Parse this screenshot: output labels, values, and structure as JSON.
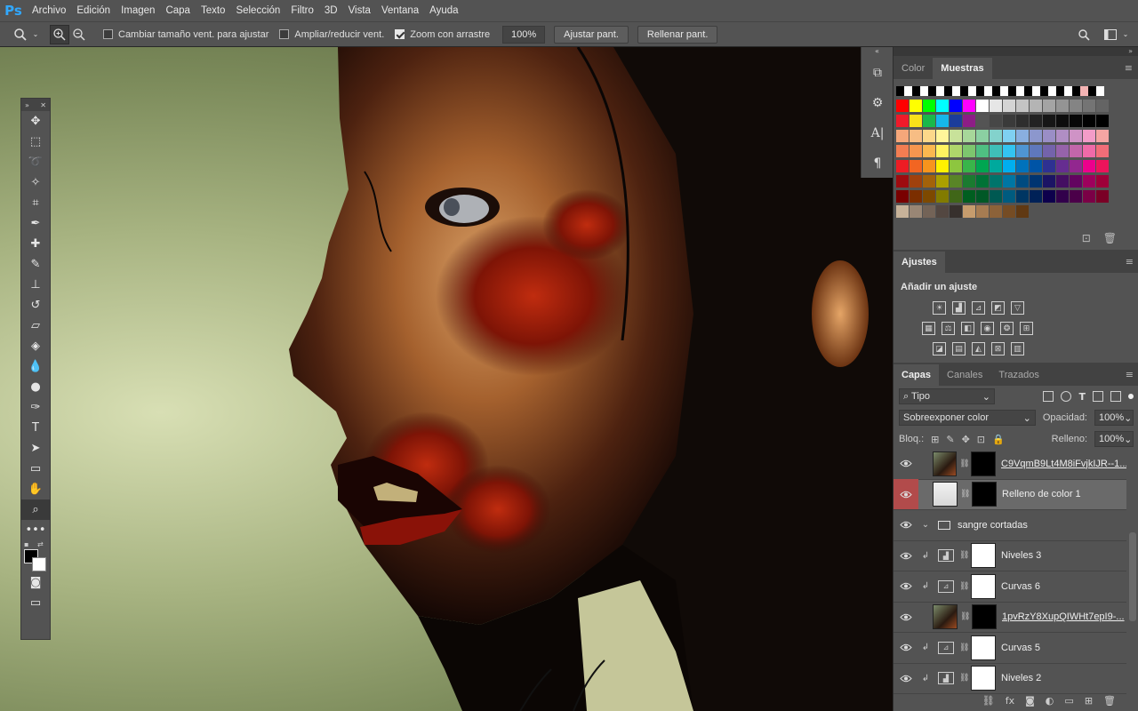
{
  "app": {
    "logo": "Ps"
  },
  "menu": [
    "Archivo",
    "Edición",
    "Imagen",
    "Capa",
    "Texto",
    "Selección",
    "Filtro",
    "3D",
    "Vista",
    "Ventana",
    "Ayuda"
  ],
  "options": {
    "resize_windows": "Cambiar tamaño vent. para ajustar",
    "zoom_all": "Ampliar/reducir vent.",
    "scrubby_zoom": "Zoom con arrastre",
    "zoom_value": "100%",
    "fit_screen": "Ajustar pant.",
    "fill_screen": "Rellenar pant."
  },
  "tools": [
    "move-icon",
    "marquee-icon",
    "lasso-icon",
    "quick-select-icon",
    "crop-icon",
    "eyedropper-icon",
    "healing-brush-icon",
    "brush-icon",
    "stamp-icon",
    "history-brush-icon",
    "eraser-icon",
    "paint-bucket-icon",
    "blur-icon",
    "dodge-icon",
    "pen-icon",
    "type-icon",
    "path-select-icon",
    "rectangle-icon",
    "hand-icon",
    "zoom-icon",
    "more-icon"
  ],
  "swatches_panel": {
    "tabs": [
      "Color",
      "Muestras"
    ],
    "active_tab": "Muestras",
    "rows": [
      [
        "#000000",
        "#ffffff",
        "#000000",
        "#ffffff",
        "#000000",
        "#ffffff",
        "#000000",
        "#ffffff",
        "#000000",
        "#ffffff",
        "#000000",
        "#ffffff",
        "#000000",
        "#ffffff",
        "#000000",
        "#ffffff",
        "#000000",
        "#ffffff",
        "#000000",
        "#ffffff",
        "#000000",
        "#ffffff",
        "#000000",
        "#f4b4b4",
        "#000000",
        "#ffffff"
      ],
      [
        "#ff0000",
        "#ffff00",
        "#00ff00",
        "#00ffff",
        "#0000ff",
        "#ff00ff",
        "#ffffff",
        "#e6e6e6",
        "#d4d4d4",
        "#c4c4c4",
        "#b4b4b4",
        "#a4a4a4",
        "#949494",
        "#848484",
        "#747474",
        "#646464"
      ],
      [
        "#ef1a2a",
        "#f8e11a",
        "#1ab84a",
        "#16b7ea",
        "#1b3c9a",
        "#8d1d86",
        "#545454",
        "#474747",
        "#3a3a3a",
        "#2e2e2e",
        "#222222",
        "#161616",
        "#0d0d0d",
        "#070707",
        "#020202",
        "#000000"
      ],
      [
        "#f5a77a",
        "#f7bd84",
        "#fcd88a",
        "#fff59a",
        "#c8e29a",
        "#a7d79a",
        "#8bd0a2",
        "#83d2cc",
        "#7fd0f1",
        "#89afdf",
        "#8c97cd",
        "#9a8ec6",
        "#b08ec4",
        "#cf93c6",
        "#f39cc8",
        "#f5a5a3"
      ],
      [
        "#f27d52",
        "#f6964f",
        "#fbb84f",
        "#fff360",
        "#afd66b",
        "#7dc66e",
        "#4fbf82",
        "#3fbfb8",
        "#33c4f1",
        "#4f95d2",
        "#5f78bc",
        "#7463ab",
        "#9663aa",
        "#c266aa",
        "#ef6aa8",
        "#f16d78"
      ],
      [
        "#ed1c24",
        "#f26522",
        "#f7941d",
        "#fff200",
        "#8dc63f",
        "#39b54a",
        "#00a651",
        "#00a99d",
        "#00aeef",
        "#0072bc",
        "#0054a6",
        "#2e3192",
        "#662d91",
        "#92278f",
        "#ec008c",
        "#ed145b"
      ],
      [
        "#9e0b0f",
        "#a0410d",
        "#a3620a",
        "#aba000",
        "#598527",
        "#1a7b30",
        "#007236",
        "#00746b",
        "#0076a3",
        "#004b80",
        "#003471",
        "#1b1464",
        "#440e62",
        "#630460",
        "#9e005d",
        "#9e0039"
      ],
      [
        "#790000",
        "#7b2e00",
        "#7d4900",
        "#827b00",
        "#406618",
        "#005e20",
        "#005826",
        "#005952",
        "#005b7f",
        "#003663",
        "#002157",
        "#0d004c",
        "#32004b",
        "#4b0049",
        "#7b0046",
        "#7a0026"
      ],
      [
        "#c7b299",
        "#998675",
        "#736357",
        "#534741",
        "#37302d",
        "#c69c6d",
        "#a67c52",
        "#8c6239",
        "#754c24",
        "#603913"
      ]
    ]
  },
  "adjustments_panel": {
    "tab": "Ajustes",
    "title": "Añadir un ajuste",
    "row1": [
      "brightness-icon",
      "levels-icon",
      "curves-icon",
      "exposure-icon",
      "vibrance-triangle-icon"
    ],
    "row2": [
      "hue-sat-icon",
      "color-balance-icon",
      "bw-icon",
      "photo-filter-icon",
      "channel-mixer-icon",
      "color-lookup-icon"
    ],
    "row3": [
      "invert-icon",
      "posterize-icon",
      "threshold-icon",
      "selective-color-icon",
      "gradient-map-icon"
    ]
  },
  "layers_panel": {
    "tabs": [
      "Capas",
      "Canales",
      "Trazados"
    ],
    "active_tab": "Capas",
    "filter": "Tipo",
    "blend_mode": "Sobreexponer color",
    "opacity_label": "Opacidad:",
    "opacity": "100%",
    "lock_label": "Bloq.:",
    "fill_label": "Relleno:",
    "fill": "100%",
    "layers": [
      {
        "name": "C9VqmB9Lt4M8iFvjkIJR--1...",
        "kind": "smart",
        "clip": false,
        "selected": false,
        "underline": true
      },
      {
        "name": "Relleno de color 1",
        "kind": "fill",
        "clip": false,
        "selected": true,
        "underline": false
      },
      {
        "name": "sangre cortadas",
        "kind": "group",
        "clip": false,
        "selected": false,
        "underline": false
      },
      {
        "name": "Niveles 3",
        "kind": "levels",
        "clip": true,
        "selected": false,
        "underline": false
      },
      {
        "name": "Curvas 6",
        "kind": "curves",
        "clip": true,
        "selected": false,
        "underline": false
      },
      {
        "name": "1pvRzY8XupQIWHt7epI9-...",
        "kind": "smart",
        "clip": false,
        "selected": false,
        "underline": true
      },
      {
        "name": "Curvas 5",
        "kind": "curves",
        "clip": true,
        "selected": false,
        "underline": false
      },
      {
        "name": "Niveles 2",
        "kind": "levels",
        "clip": true,
        "selected": false,
        "underline": false
      }
    ],
    "footer_icons": [
      "link-icon",
      "fx-icon",
      "mask-icon",
      "adjustment-icon",
      "folder-icon",
      "new-layer-icon",
      "trash-icon"
    ]
  }
}
